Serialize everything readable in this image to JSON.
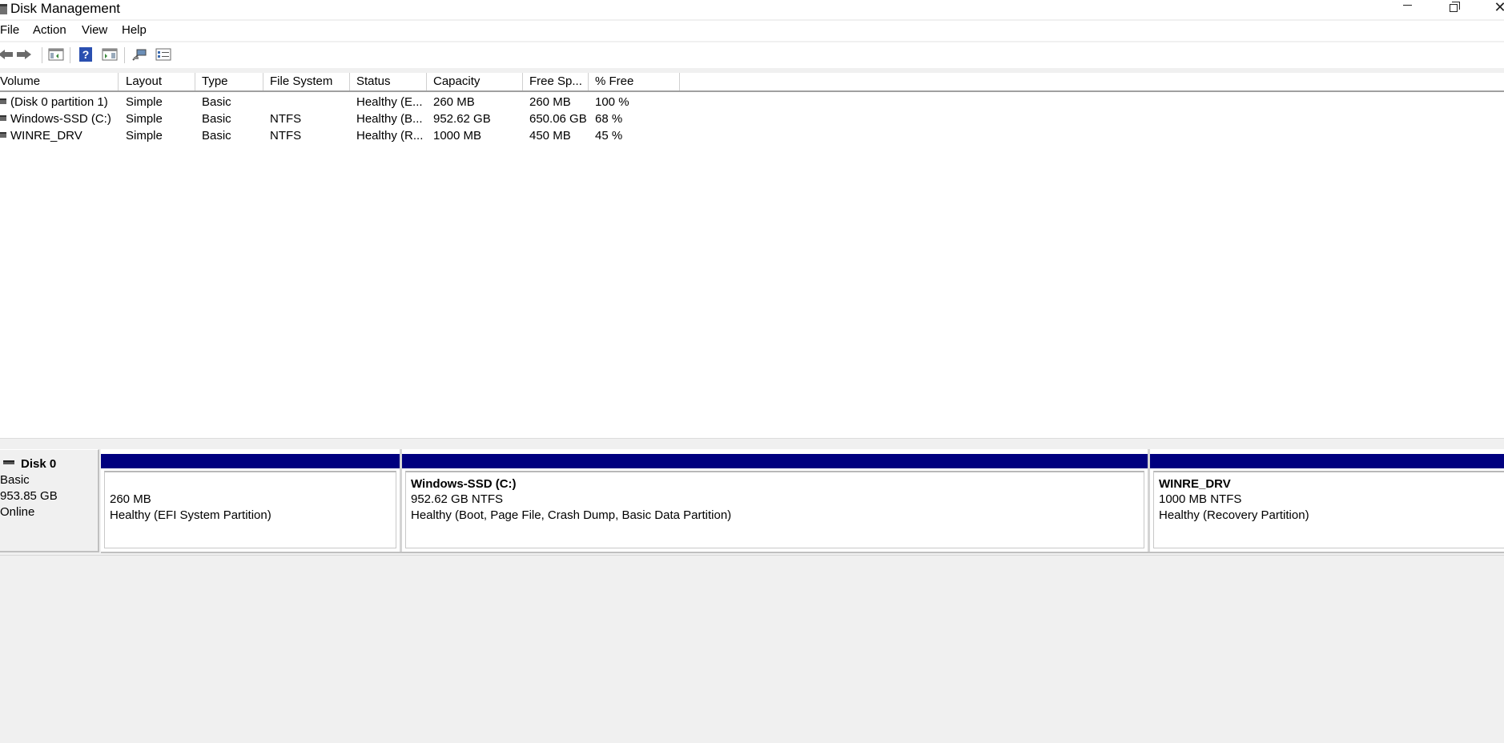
{
  "window": {
    "title": "Disk Management",
    "minimize_glyph": "─",
    "maximize_glyph": "❐",
    "close_glyph": "✕"
  },
  "menu": {
    "items": [
      "File",
      "Action",
      "View",
      "Help"
    ]
  },
  "toolbar": {
    "icons": [
      "back-arrow-icon",
      "forward-arrow-icon",
      "show-hide-console-tree-icon",
      "help-icon",
      "properties-pane-icon",
      "connect-icon",
      "settings-list-icon"
    ]
  },
  "volume_list": {
    "columns": [
      "Volume",
      "Layout",
      "Type",
      "File System",
      "Status",
      "Capacity",
      "Free Sp...",
      "% Free"
    ],
    "rows": [
      [
        "(Disk 0 partition 1)",
        "Simple",
        "Basic",
        "",
        "Healthy (E...",
        "260 MB",
        "260 MB",
        "100 %"
      ],
      [
        "Windows-SSD (C:)",
        "Simple",
        "Basic",
        "NTFS",
        "Healthy (B...",
        "952.62 GB",
        "650.06 GB",
        "68 %"
      ],
      [
        "WINRE_DRV",
        "Simple",
        "Basic",
        "NTFS",
        "Healthy (R...",
        "1000 MB",
        "450 MB",
        "45 %"
      ]
    ]
  },
  "disk": {
    "name": "Disk 0",
    "type": "Basic",
    "size": "953.85 GB",
    "state": "Online",
    "partitions": [
      {
        "name": "",
        "size_fs": "260 MB",
        "status": "Healthy (EFI System Partition)"
      },
      {
        "name": "Windows-SSD  (C:)",
        "size_fs": "952.62 GB NTFS",
        "status": "Healthy (Boot, Page File, Crash Dump, Basic Data Partition)"
      },
      {
        "name": "WINRE_DRV",
        "size_fs": "1000 MB NTFS",
        "status": "Healthy (Recovery Partition)"
      }
    ]
  },
  "colors": {
    "partition_bar": "#00007f",
    "pane_background": "#f0f0f0",
    "help_icon": "#2a4fb0"
  }
}
